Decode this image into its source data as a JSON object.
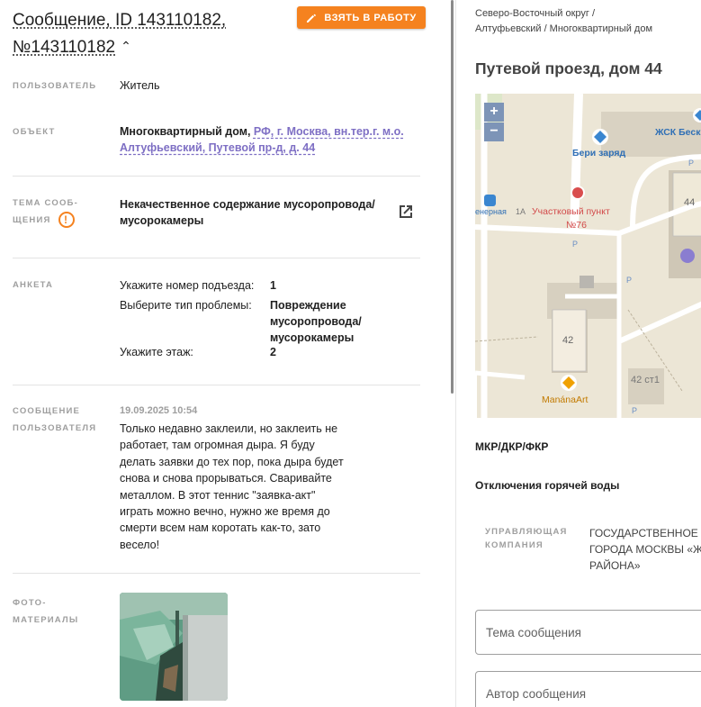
{
  "header": {
    "title_line1": "Сообщение, ID 143110182,",
    "title_line2": "№143110182",
    "take_button": "ВЗЯТЬ В РАБОТУ"
  },
  "details": {
    "user_label": "ПОЛЬЗОВАТЕЛЬ",
    "user_value": "Житель",
    "object_label": "ОБЪЕКТ",
    "object_type": "Многоквартирный дом,",
    "object_address_line1": "РФ, г. Москва, вн.тер.г. м.о.",
    "object_address_line2": "Алтуфьевский, Путевой пр-д, д. 44",
    "topic_label_1": "ТЕМА СООБ-",
    "topic_label_2": "ЩЕНИЯ",
    "topic_value_1": "Некачественное содержание мусоропровода/",
    "topic_value_2": "мусорокамеры",
    "survey_label": "АНКЕТА",
    "survey": [
      {
        "q": "Укажите номер подъезда:",
        "a": "1"
      },
      {
        "q": "Выберите тип проблемы:",
        "a": "Повреждение мусоропровода/ мусорокамеры"
      },
      {
        "q": "Укажите этаж:",
        "a": "2"
      }
    ],
    "message_label_1": "СООБЩЕНИЕ",
    "message_label_2": "ПОЛЬЗОВАТЕЛЯ",
    "message_date": "19.09.2025 10:54",
    "message_text": "Только недавно заклеили, но заклеить не работает, там огромная дыра. Я буду делать заявки до тех пор, пока дыра будет снова и снова прорываться. Сваривайте металлом. В этот теннис \"заявка-акт\" играть можно вечно, нужно же время до смерти всем нам коротать как-то, зато весело!",
    "photos_label_1": "ФОТО-",
    "photos_label_2": "МАТЕРИАЛЫ"
  },
  "right": {
    "breadcrumb_1": "Северо-Восточный округ /",
    "breadcrumb_2": "Алтуфьевский / Многоквартирный дом",
    "address": "Путевой проезд, дом 44",
    "map": {
      "zoom_in": "+",
      "zoom_out": "−",
      "poi_charge": "Бери заряд",
      "poi_zhsk": "ЖСК Беск",
      "poi_police_1": "Участковый пункт",
      "poi_police_2": "№76",
      "poi_station": "енерная",
      "poi_1a": "1А",
      "house_44": "44",
      "house_42": "42",
      "house_42_1": "42 ст1",
      "poi_manana": "ManánaArt",
      "parking": "P"
    },
    "section_mkr": "МКР/ДКР/ФКР",
    "section_hot_water": "Отключения горячей воды",
    "mgmt_label_1": "УПРАВЛЯЮЩАЯ",
    "mgmt_label_2": "КОМПАНИЯ",
    "mgmt_value_1": "ГОСУДАРСТВЕННОЕ Б",
    "mgmt_value_2": "ГОРОДА МОСКВЫ «Ж",
    "mgmt_value_3": "РАЙОНА»",
    "field_topic_placeholder": "Тема сообщения",
    "field_author_placeholder": "Автор сообщения"
  }
}
